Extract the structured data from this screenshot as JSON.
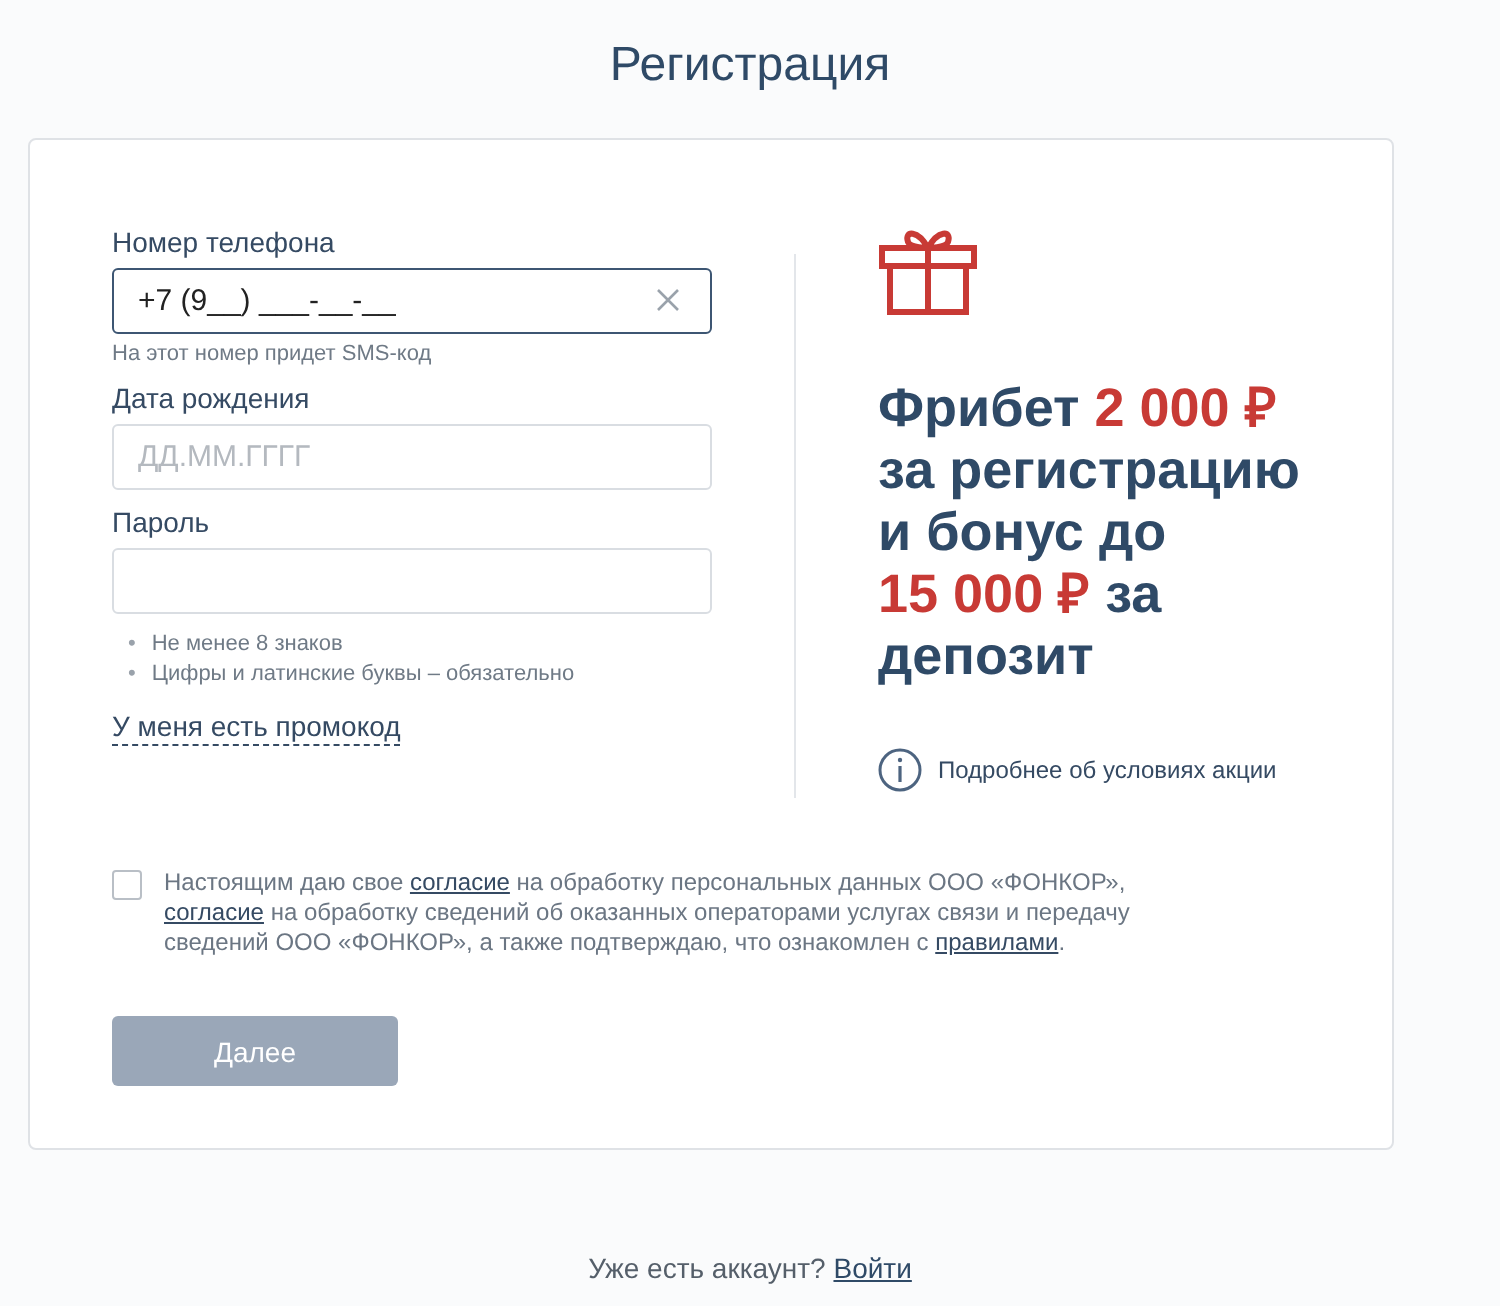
{
  "title": "Регистрация",
  "form": {
    "fields": [
      {
        "kind": "phone",
        "label": "Номер телефона",
        "value": "+7 (9__) ___-__-__",
        "focused": true,
        "hint": "На этот номер придет SMS-код"
      },
      {
        "kind": "date",
        "label": "Дата рождения",
        "placeholder": "ДД.ММ.ГГГГ",
        "focused": false
      },
      {
        "kind": "password",
        "label": "Пароль",
        "focused": false,
        "rules": [
          {
            "marker": "•",
            "text": "Не менее 8 знаков"
          },
          {
            "marker": "•",
            "text": "Цифры и латинские буквы – обязательно"
          }
        ]
      }
    ],
    "promo_link": "У меня есть промокод"
  },
  "promo": {
    "lines": [
      [
        {
          "text": "Фрибет ",
          "accent": false
        },
        {
          "text": "2 000 ₽",
          "accent": true
        }
      ],
      [
        {
          "text": "за регистрацию",
          "accent": false
        }
      ],
      [
        {
          "text": "и бонус до",
          "accent": false
        }
      ],
      [
        {
          "text": "15 000 ₽",
          "accent": true
        },
        {
          "text": " за",
          "accent": false
        }
      ],
      [
        {
          "text": "депозит",
          "accent": false
        }
      ]
    ],
    "details_link": "Подробнее об условиях акции"
  },
  "consent": {
    "checked": false,
    "parts": [
      {
        "kind": "text",
        "text": "Настоящим даю свое "
      },
      {
        "kind": "link",
        "text": "согласие"
      },
      {
        "kind": "text",
        "text": " на обработку персональных данных ООО «ФОНКОР», "
      },
      {
        "kind": "link",
        "text": "согласие"
      },
      {
        "kind": "text",
        "text": " на обработку сведений об оказанных операторами услугах связи и передачу сведений ООО «ФОНКОР», а также подтверждаю, что ознакомлен с "
      },
      {
        "kind": "link",
        "text": "правилами"
      },
      {
        "kind": "text",
        "text": "."
      }
    ]
  },
  "submit": {
    "label": "Далее",
    "disabled": true
  },
  "footer": {
    "text": "Уже есть аккаунт?",
    "link": "Войти"
  }
}
